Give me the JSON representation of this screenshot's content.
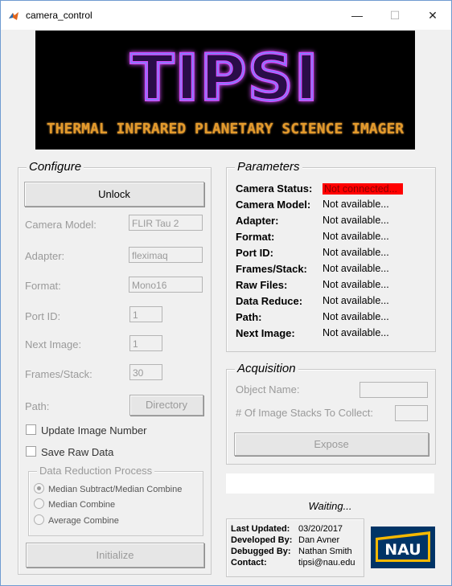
{
  "window": {
    "title": "camera_control",
    "minimize": "—",
    "maximize": "☐",
    "close": "✕"
  },
  "banner": {
    "logo_text": "TIPSI",
    "subtitle": "THERMAL INFRARED PLANETARY SCIENCE IMAGER"
  },
  "configure": {
    "title": "Configure",
    "unlock_label": "Unlock",
    "camera_model_label": "Camera Model:",
    "camera_model_value": "FLIR Tau 2",
    "adapter_label": "Adapter:",
    "adapter_value": "fleximaq",
    "format_label": "Format:",
    "format_value": "Mono16",
    "port_id_label": "Port ID:",
    "port_id_value": "1",
    "next_image_label": "Next Image:",
    "next_image_value": "1",
    "frames_stack_label": "Frames/Stack:",
    "frames_stack_value": "30",
    "path_label": "Path:",
    "directory_label": "Directory",
    "update_image_number": "Update Image Number",
    "save_raw_data": "Save Raw Data",
    "data_reduction": {
      "title": "Data Reduction Process",
      "options": [
        "Median Subtract/Median Combine",
        "Median Combine",
        "Average Combine"
      ],
      "selected": "Median Subtract/Median Combine"
    },
    "initialize_label": "Initialize"
  },
  "parameters": {
    "title": "Parameters",
    "rows": [
      {
        "label": "Camera Status:",
        "value": "Not connected..."
      },
      {
        "label": "Camera Model:",
        "value": "Not available..."
      },
      {
        "label": "Adapter:",
        "value": "Not available..."
      },
      {
        "label": "Format:",
        "value": "Not available..."
      },
      {
        "label": "Port ID:",
        "value": "Not available..."
      },
      {
        "label": "Frames/Stack:",
        "value": "Not available..."
      },
      {
        "label": "Raw Files:",
        "value": "Not available..."
      },
      {
        "label": "Data Reduce:",
        "value": "Not available..."
      },
      {
        "label": "Path:",
        "value": "Not available..."
      },
      {
        "label": "Next Image:",
        "value": "Not available..."
      }
    ],
    "status_color": "#ff0000"
  },
  "acquisition": {
    "title": "Acquisition",
    "object_name_label": "Object Name:",
    "stacks_label": "# Of Image Stacks To Collect:",
    "expose_label": "Expose"
  },
  "status_text": "Waiting...",
  "info": {
    "last_updated_label": "Last Updated:",
    "last_updated_value": "03/20/2017",
    "developed_by_label": "Developed By:",
    "developed_by_value": "Dan Avner",
    "debugged_by_label": "Debugged By:",
    "debugged_by_value": "Nathan Smith",
    "contact_label": "Contact:",
    "contact_value": "tipsi@nau.edu"
  },
  "nau_logo": {
    "text": "NAU",
    "bg_color": "#003466",
    "accent_color": "#f5b800"
  }
}
